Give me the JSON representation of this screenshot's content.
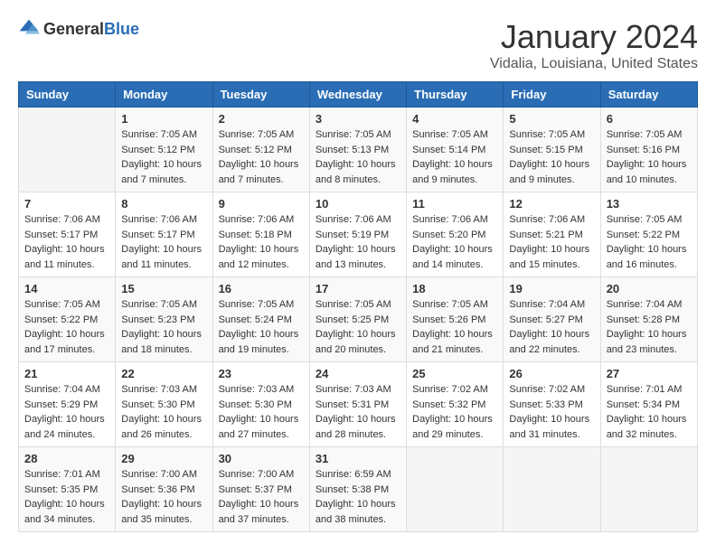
{
  "header": {
    "logo": {
      "general": "General",
      "blue": "Blue"
    },
    "title": "January 2024",
    "subtitle": "Vidalia, Louisiana, United States"
  },
  "calendar": {
    "columns": [
      "Sunday",
      "Monday",
      "Tuesday",
      "Wednesday",
      "Thursday",
      "Friday",
      "Saturday"
    ],
    "weeks": [
      [
        {
          "day": "",
          "empty": true
        },
        {
          "day": "1",
          "sunrise": "7:05 AM",
          "sunset": "5:12 PM",
          "daylight": "10 hours and 7 minutes."
        },
        {
          "day": "2",
          "sunrise": "7:05 AM",
          "sunset": "5:12 PM",
          "daylight": "10 hours and 7 minutes."
        },
        {
          "day": "3",
          "sunrise": "7:05 AM",
          "sunset": "5:13 PM",
          "daylight": "10 hours and 8 minutes."
        },
        {
          "day": "4",
          "sunrise": "7:05 AM",
          "sunset": "5:14 PM",
          "daylight": "10 hours and 9 minutes."
        },
        {
          "day": "5",
          "sunrise": "7:05 AM",
          "sunset": "5:15 PM",
          "daylight": "10 hours and 9 minutes."
        },
        {
          "day": "6",
          "sunrise": "7:05 AM",
          "sunset": "5:16 PM",
          "daylight": "10 hours and 10 minutes."
        }
      ],
      [
        {
          "day": "7",
          "sunrise": "7:06 AM",
          "sunset": "5:17 PM",
          "daylight": "10 hours and 11 minutes."
        },
        {
          "day": "8",
          "sunrise": "7:06 AM",
          "sunset": "5:17 PM",
          "daylight": "10 hours and 11 minutes."
        },
        {
          "day": "9",
          "sunrise": "7:06 AM",
          "sunset": "5:18 PM",
          "daylight": "10 hours and 12 minutes."
        },
        {
          "day": "10",
          "sunrise": "7:06 AM",
          "sunset": "5:19 PM",
          "daylight": "10 hours and 13 minutes."
        },
        {
          "day": "11",
          "sunrise": "7:06 AM",
          "sunset": "5:20 PM",
          "daylight": "10 hours and 14 minutes."
        },
        {
          "day": "12",
          "sunrise": "7:06 AM",
          "sunset": "5:21 PM",
          "daylight": "10 hours and 15 minutes."
        },
        {
          "day": "13",
          "sunrise": "7:05 AM",
          "sunset": "5:22 PM",
          "daylight": "10 hours and 16 minutes."
        }
      ],
      [
        {
          "day": "14",
          "sunrise": "7:05 AM",
          "sunset": "5:22 PM",
          "daylight": "10 hours and 17 minutes."
        },
        {
          "day": "15",
          "sunrise": "7:05 AM",
          "sunset": "5:23 PM",
          "daylight": "10 hours and 18 minutes."
        },
        {
          "day": "16",
          "sunrise": "7:05 AM",
          "sunset": "5:24 PM",
          "daylight": "10 hours and 19 minutes."
        },
        {
          "day": "17",
          "sunrise": "7:05 AM",
          "sunset": "5:25 PM",
          "daylight": "10 hours and 20 minutes."
        },
        {
          "day": "18",
          "sunrise": "7:05 AM",
          "sunset": "5:26 PM",
          "daylight": "10 hours and 21 minutes."
        },
        {
          "day": "19",
          "sunrise": "7:04 AM",
          "sunset": "5:27 PM",
          "daylight": "10 hours and 22 minutes."
        },
        {
          "day": "20",
          "sunrise": "7:04 AM",
          "sunset": "5:28 PM",
          "daylight": "10 hours and 23 minutes."
        }
      ],
      [
        {
          "day": "21",
          "sunrise": "7:04 AM",
          "sunset": "5:29 PM",
          "daylight": "10 hours and 24 minutes."
        },
        {
          "day": "22",
          "sunrise": "7:03 AM",
          "sunset": "5:30 PM",
          "daylight": "10 hours and 26 minutes."
        },
        {
          "day": "23",
          "sunrise": "7:03 AM",
          "sunset": "5:30 PM",
          "daylight": "10 hours and 27 minutes."
        },
        {
          "day": "24",
          "sunrise": "7:03 AM",
          "sunset": "5:31 PM",
          "daylight": "10 hours and 28 minutes."
        },
        {
          "day": "25",
          "sunrise": "7:02 AM",
          "sunset": "5:32 PM",
          "daylight": "10 hours and 29 minutes."
        },
        {
          "day": "26",
          "sunrise": "7:02 AM",
          "sunset": "5:33 PM",
          "daylight": "10 hours and 31 minutes."
        },
        {
          "day": "27",
          "sunrise": "7:01 AM",
          "sunset": "5:34 PM",
          "daylight": "10 hours and 32 minutes."
        }
      ],
      [
        {
          "day": "28",
          "sunrise": "7:01 AM",
          "sunset": "5:35 PM",
          "daylight": "10 hours and 34 minutes."
        },
        {
          "day": "29",
          "sunrise": "7:00 AM",
          "sunset": "5:36 PM",
          "daylight": "10 hours and 35 minutes."
        },
        {
          "day": "30",
          "sunrise": "7:00 AM",
          "sunset": "5:37 PM",
          "daylight": "10 hours and 37 minutes."
        },
        {
          "day": "31",
          "sunrise": "6:59 AM",
          "sunset": "5:38 PM",
          "daylight": "10 hours and 38 minutes."
        },
        {
          "day": "",
          "empty": true
        },
        {
          "day": "",
          "empty": true
        },
        {
          "day": "",
          "empty": true
        }
      ]
    ]
  },
  "labels": {
    "sunrise": "Sunrise:",
    "sunset": "Sunset:",
    "daylight": "Daylight:"
  }
}
